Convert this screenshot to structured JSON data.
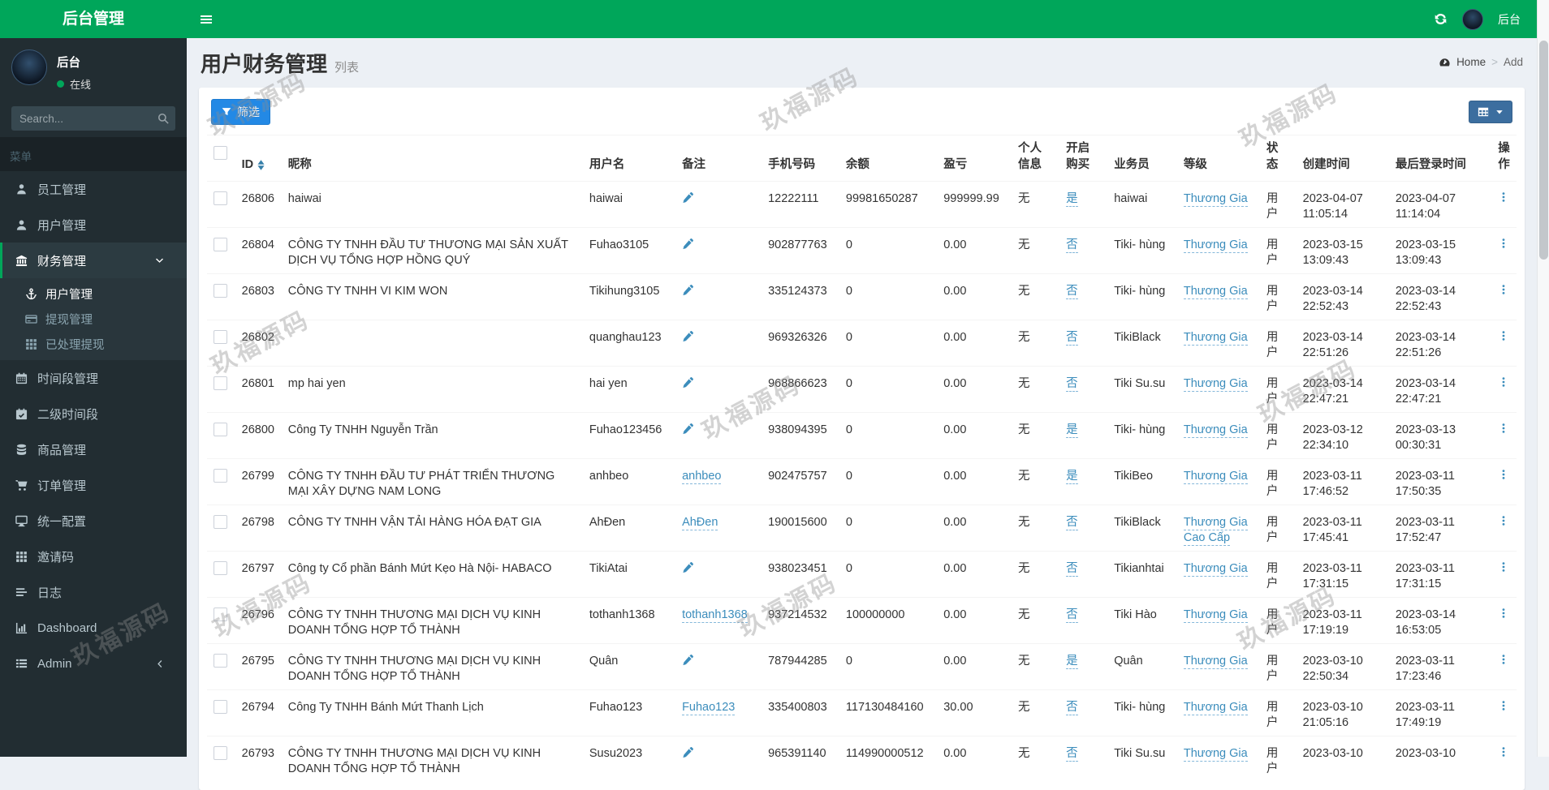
{
  "topbar": {
    "brand": "后台管理",
    "user": "后台"
  },
  "sidebar": {
    "user": {
      "name": "后台",
      "status": "在线"
    },
    "search_placeholder": "Search...",
    "menu_label": "菜单",
    "items": [
      {
        "key": "staff-management",
        "label": "员工管理",
        "icon": "user-tie"
      },
      {
        "key": "user-management",
        "label": "用户管理",
        "icon": "user"
      },
      {
        "key": "finance-management",
        "label": "财务管理",
        "icon": "bank",
        "active": true,
        "expanded": true,
        "children": [
          {
            "key": "finance-user-management",
            "label": "用户管理",
            "icon": "anchor",
            "active": true
          },
          {
            "key": "withdraw-management",
            "label": "提现管理",
            "icon": "credit-card"
          },
          {
            "key": "processed-withdraw",
            "label": "已处理提现",
            "icon": "th"
          }
        ]
      },
      {
        "key": "timeslot-management",
        "label": "时间段管理",
        "icon": "calendar"
      },
      {
        "key": "sub-timeslot",
        "label": "二级时间段",
        "icon": "calendar-check"
      },
      {
        "key": "product-management",
        "label": "商品管理",
        "icon": "database"
      },
      {
        "key": "order-management",
        "label": "订单管理",
        "icon": "cart"
      },
      {
        "key": "unified-config",
        "label": "统一配置",
        "icon": "desktop"
      },
      {
        "key": "invite-code",
        "label": "邀请码",
        "icon": "th"
      },
      {
        "key": "logs",
        "label": "日志",
        "icon": "list"
      },
      {
        "key": "dashboard",
        "label": "Dashboard",
        "icon": "chart"
      },
      {
        "key": "admin",
        "label": "Admin",
        "icon": "list-alt",
        "collapsed": true
      }
    ]
  },
  "page": {
    "title": "用户财务管理",
    "subtitle": "列表",
    "breadcrumb": {
      "home": "Home",
      "separator": ">",
      "current": "Add"
    }
  },
  "toolbar": {
    "filter_label": "筛选"
  },
  "table": {
    "columns": [
      "ID",
      "昵称",
      "用户名",
      "备注",
      "手机号码",
      "余额",
      "盈亏",
      "个人信息",
      "开启购买",
      "业务员",
      "等级",
      "状态",
      "创建时间",
      "最后登录时间",
      "操作"
    ],
    "rows": [
      {
        "id": "26806",
        "nickname": "haiwai",
        "username": "haiwai",
        "remark": null,
        "phone": "12222111",
        "balance": "99981650287",
        "profit": "999999.99",
        "personal_info": "无",
        "buy": "是",
        "salesman": "haiwai",
        "level": "Thương Gia",
        "status": "用户",
        "created": "2023-04-07 11:05:14",
        "last_login": "2023-04-07 11:14:04"
      },
      {
        "id": "26804",
        "nickname": "CÔNG TY TNHH ĐẦU TƯ THƯƠNG MẠI SẢN XUẤT DỊCH VỤ TỔNG HỢP HỒNG QUÝ",
        "username": "Fuhao3105",
        "remark": null,
        "phone": "902877763",
        "balance": "0",
        "profit": "0.00",
        "personal_info": "无",
        "buy": "否",
        "salesman": "Tiki- hùng",
        "level": "Thương Gia",
        "status": "用户",
        "created": "2023-03-15 13:09:43",
        "last_login": "2023-03-15 13:09:43"
      },
      {
        "id": "26803",
        "nickname": "CÔNG TY TNHH VI KIM WON",
        "username": "Tikihung3105",
        "remark": null,
        "phone": "335124373",
        "balance": "0",
        "profit": "0.00",
        "personal_info": "无",
        "buy": "否",
        "salesman": "Tiki- hùng",
        "level": "Thương Gia",
        "status": "用户",
        "created": "2023-03-14 22:52:43",
        "last_login": "2023-03-14 22:52:43"
      },
      {
        "id": "26802",
        "nickname": "",
        "username": "quanghau123",
        "remark": null,
        "phone": "969326326",
        "balance": "0",
        "profit": "0.00",
        "personal_info": "无",
        "buy": "否",
        "salesman": "TikiBlack",
        "level": "Thương Gia",
        "status": "用户",
        "created": "2023-03-14 22:51:26",
        "last_login": "2023-03-14 22:51:26"
      },
      {
        "id": "26801",
        "nickname": "mp hai yen",
        "username": "hai yen",
        "remark": null,
        "phone": "968866623",
        "balance": "0",
        "profit": "0.00",
        "personal_info": "无",
        "buy": "否",
        "salesman": "Tiki Su.su",
        "level": "Thương Gia",
        "status": "用户",
        "created": "2023-03-14 22:47:21",
        "last_login": "2023-03-14 22:47:21"
      },
      {
        "id": "26800",
        "nickname": "Công Ty TNHH Nguyễn Trần",
        "username": "Fuhao123456",
        "remark": null,
        "phone": "938094395",
        "balance": "0",
        "profit": "0.00",
        "personal_info": "无",
        "buy": "是",
        "salesman": "Tiki- hùng",
        "level": "Thương Gia",
        "status": "用户",
        "created": "2023-03-12 22:34:10",
        "last_login": "2023-03-13 00:30:31"
      },
      {
        "id": "26799",
        "nickname": "CÔNG TY TNHH ĐẦU TƯ PHÁT TRIỂN THƯƠNG MẠI XÂY DỰNG NAM LONG",
        "username": "anhbeo",
        "remark": "anhbeo",
        "phone": "902475757",
        "balance": "0",
        "profit": "0.00",
        "personal_info": "无",
        "buy": "是",
        "salesman": "TikiBeo",
        "level": "Thương Gia",
        "status": "用户",
        "created": "2023-03-11 17:46:52",
        "last_login": "2023-03-11 17:50:35"
      },
      {
        "id": "26798",
        "nickname": "CÔNG TY TNHH VẬN TẢI HÀNG HÓA ĐẠT GIA",
        "username": "AhĐen",
        "remark": "AhĐen",
        "phone": "190015600",
        "balance": "0",
        "profit": "0.00",
        "personal_info": "无",
        "buy": "否",
        "salesman": "TikiBlack",
        "level": "Thương Gia Cao Cấp",
        "status": "用户",
        "created": "2023-03-11 17:45:41",
        "last_login": "2023-03-11 17:52:47"
      },
      {
        "id": "26797",
        "nickname": "Công ty Cổ phần Bánh Mứt Kẹo Hà Nội- HABACO",
        "username": "TikiAtai",
        "remark": null,
        "phone": "938023451",
        "balance": "0",
        "profit": "0.00",
        "personal_info": "无",
        "buy": "否",
        "salesman": "Tikianhtai",
        "level": "Thương Gia",
        "status": "用户",
        "created": "2023-03-11 17:31:15",
        "last_login": "2023-03-11 17:31:15"
      },
      {
        "id": "26796",
        "nickname": "CÔNG TY TNHH THƯƠNG MẠI DỊCH VỤ KINH DOANH TỔNG HỢP TỔ THÀNH",
        "username": "tothanh1368",
        "remark": "tothanh1368",
        "phone": "937214532",
        "balance": "100000000",
        "profit": "0.00",
        "personal_info": "无",
        "buy": "否",
        "salesman": "Tiki Hào",
        "level": "Thương Gia",
        "status": "用户",
        "created": "2023-03-11 17:19:19",
        "last_login": "2023-03-14 16:53:05"
      },
      {
        "id": "26795",
        "nickname": "CÔNG TY TNHH THƯƠNG MẠI DỊCH VỤ KINH DOANH TỔNG HỢP TỔ THÀNH",
        "username": "Quân",
        "remark": null,
        "phone": "787944285",
        "balance": "0",
        "profit": "0.00",
        "personal_info": "无",
        "buy": "是",
        "salesman": "Quân",
        "level": "Thương Gia",
        "status": "用户",
        "created": "2023-03-10 22:50:34",
        "last_login": "2023-03-11 17:23:46"
      },
      {
        "id": "26794",
        "nickname": "Công Ty TNHH Bánh Mứt Thanh Lịch",
        "username": "Fuhao123",
        "remark": "Fuhao123",
        "phone": "335400803",
        "balance": "117130484160",
        "profit": "30.00",
        "personal_info": "无",
        "buy": "否",
        "salesman": "Tiki- hùng",
        "level": "Thương Gia",
        "status": "用户",
        "created": "2023-03-10 21:05:16",
        "last_login": "2023-03-11 17:49:19"
      },
      {
        "id": "26793",
        "nickname": "CÔNG TY TNHH THƯƠNG MẠI DỊCH VỤ KINH DOANH TỔNG HỢP TỔ THÀNH",
        "username": "Susu2023",
        "remark": null,
        "phone": "965391140",
        "balance": "114990000512",
        "profit": "0.00",
        "personal_info": "无",
        "buy": "否",
        "salesman": "Tiki Su.su",
        "level": "Thương Gia",
        "status": "用户",
        "created": "2023-03-10",
        "last_login": "2023-03-10"
      }
    ]
  },
  "watermark": {
    "text": "玖福源码"
  },
  "colors": {
    "accent_green": "#00a65a",
    "link_blue": "#3c8dbc",
    "filter_button_blue": "#2389e5",
    "grid_button_blue": "#3c6e9f",
    "sidebar_bg": "#222d32",
    "content_bg": "#ecf0f5"
  }
}
